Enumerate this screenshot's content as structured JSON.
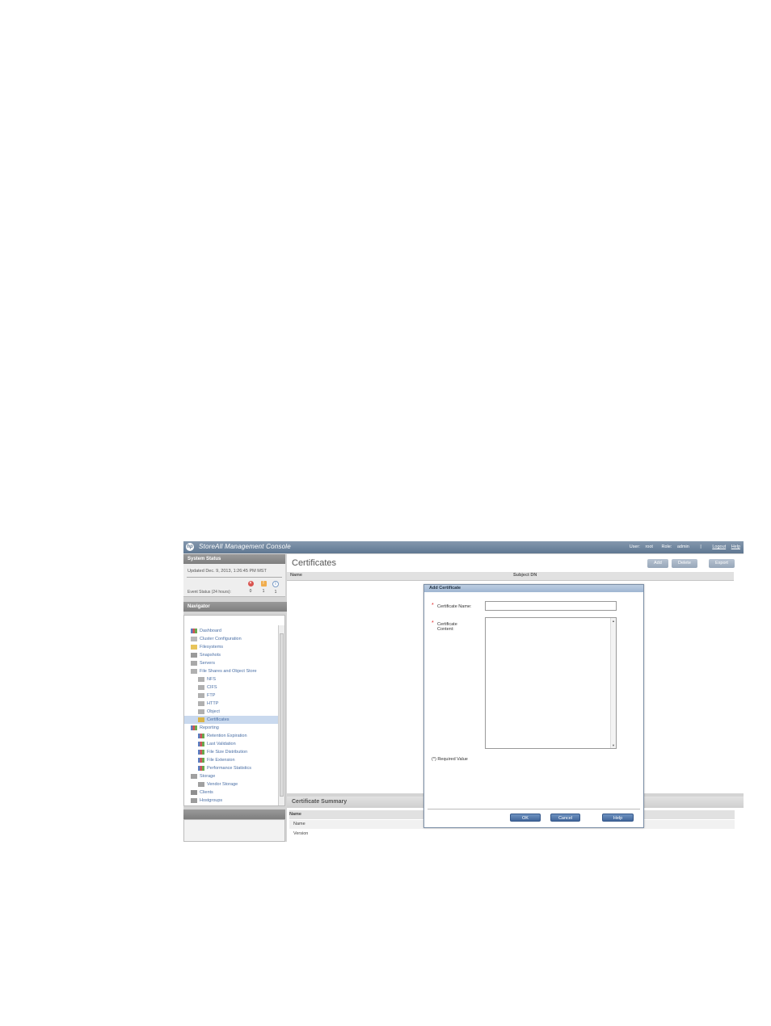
{
  "app": {
    "title": "StoreAll Management Console",
    "logo_text": "hp"
  },
  "header": {
    "user_label": "User:",
    "user": "root",
    "role_label": "Role:",
    "role": "admin",
    "divider": "|",
    "logout": "Logout",
    "help": "Help"
  },
  "system_status": {
    "title": "System Status",
    "updated": "Updated Dec. 9, 2013, 1:26:45 PM MST",
    "event_label": "Event Status (24 hours):",
    "critical": "0",
    "warning": "1",
    "info": "1"
  },
  "navigator": {
    "title": "Navigator",
    "items": [
      {
        "label": "Dashboard",
        "icon": "chart-icon"
      },
      {
        "label": "Cluster Configuration",
        "icon": "gear-icon"
      },
      {
        "label": "Filesystems",
        "icon": "folder-icon"
      },
      {
        "label": "Snapshots",
        "icon": "snapshot-icon"
      },
      {
        "label": "Servers",
        "icon": "server-icon"
      },
      {
        "label": "File Shares and Object Store",
        "icon": "share-icon"
      },
      {
        "label": "NFS",
        "icon": "share-icon"
      },
      {
        "label": "CIFS",
        "icon": "share-icon"
      },
      {
        "label": "FTP",
        "icon": "share-icon"
      },
      {
        "label": "HTTP",
        "icon": "share-icon"
      },
      {
        "label": "Object",
        "icon": "share-icon"
      },
      {
        "label": "Certificates",
        "icon": "certificate-icon"
      },
      {
        "label": "Reporting",
        "icon": "chart-icon"
      },
      {
        "label": "Retention Expiration",
        "icon": "chart-icon"
      },
      {
        "label": "Last Validation",
        "icon": "chart-icon"
      },
      {
        "label": "File Size Distribution",
        "icon": "chart-icon"
      },
      {
        "label": "File Extension",
        "icon": "chart-icon"
      },
      {
        "label": "Performance Statistics",
        "icon": "chart-icon"
      },
      {
        "label": "Storage",
        "icon": "storage-icon"
      },
      {
        "label": "Vendor Storage",
        "icon": "storage-icon"
      },
      {
        "label": "Clients",
        "icon": "client-icon"
      },
      {
        "label": "Hostgroups",
        "icon": "hostgroup-icon"
      }
    ],
    "selected": "Certificates"
  },
  "main": {
    "title": "Certificates",
    "buttons": {
      "add": "Add",
      "delete": "Delete",
      "export": "Export"
    },
    "columns": [
      "Name",
      "Subject DN"
    ]
  },
  "summary": {
    "title": "Certificate Summary",
    "column": "Name",
    "rows": [
      "Name",
      "Version"
    ]
  },
  "dialog": {
    "title": "Add Certificate",
    "required_mark": "*",
    "name_label": "Certificate Name:",
    "content_label_1": "Certificate",
    "content_label_2": "Content:",
    "name_value": "",
    "content_value": "",
    "required_note": "(*) Required Value",
    "ok": "OK",
    "cancel": "Cancel",
    "help": "Help"
  },
  "colors": {
    "header_bar": "#5f7791",
    "link": "#4a6fa5",
    "selected_row": "#c9d9ee",
    "button": "#41669a",
    "critical": "#d9534f",
    "warning": "#f0ad4e",
    "info": "#7a9cc6"
  }
}
